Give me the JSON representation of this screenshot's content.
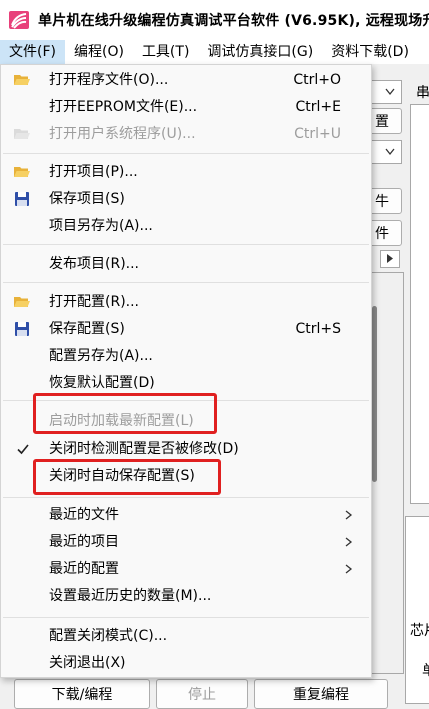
{
  "window": {
    "title": "单片机在线升级编程仿真调试平台软件 (V6.95K), 远程现场升"
  },
  "menubar": {
    "items": [
      {
        "label": "文件(F)"
      },
      {
        "label": "编程(O)"
      },
      {
        "label": "工具(T)"
      },
      {
        "label": "调试仿真接口(G)"
      },
      {
        "label": "资料下载(D)"
      }
    ]
  },
  "file_menu": {
    "open_program": {
      "label": "打开程序文件(O)...",
      "shortcut": "Ctrl+O"
    },
    "open_eeprom": {
      "label": "打开EEPROM文件(E)...",
      "shortcut": "Ctrl+E"
    },
    "open_user_system": {
      "label": "打开用户系统程序(U)...",
      "shortcut": "Ctrl+U"
    },
    "open_project": {
      "label": "打开项目(P)..."
    },
    "save_project": {
      "label": "保存项目(S)"
    },
    "save_project_as": {
      "label": "项目另存为(A)..."
    },
    "publish_project": {
      "label": "发布项目(R)..."
    },
    "open_config": {
      "label": "打开配置(R)..."
    },
    "save_config": {
      "label": "保存配置(S)",
      "shortcut": "Ctrl+S"
    },
    "save_config_as": {
      "label": "配置另存为(A)..."
    },
    "restore_default": {
      "label": "恢复默认配置(D)"
    },
    "load_latest_on_start": {
      "label": "启动时加载最新配置(L)"
    },
    "check_modified_on_close": {
      "label": "关闭时检测配置是否被修改(D)",
      "checked": true
    },
    "autosave_on_close": {
      "label": "关闭时自动保存配置(S)"
    },
    "recent_files": {
      "label": "最近的文件"
    },
    "recent_projects": {
      "label": "最近的项目"
    },
    "recent_configs": {
      "label": "最近的配置"
    },
    "set_history_count": {
      "label": "设置最近历史的数量(M)..."
    },
    "config_close_mode": {
      "label": "配置关闭模式(C)..."
    },
    "exit": {
      "label": "关闭退出(X)"
    }
  },
  "background": {
    "btn_config_fragment": "置",
    "btn_file_fragment_1": "牛",
    "btn_file_fragment_2": "件",
    "right_panel_fragment": "串",
    "bottom_left_label": "芯片",
    "bottom_right_fragment": "单",
    "download_program": "下载/编程",
    "stop": "停止",
    "repeat_program": "重复编程"
  },
  "colors": {
    "highlight_box": "#e02020",
    "menu_bg": "#f9f9f9",
    "disabled_text": "#9d9d9d",
    "active_menu": "#cce4f7"
  }
}
